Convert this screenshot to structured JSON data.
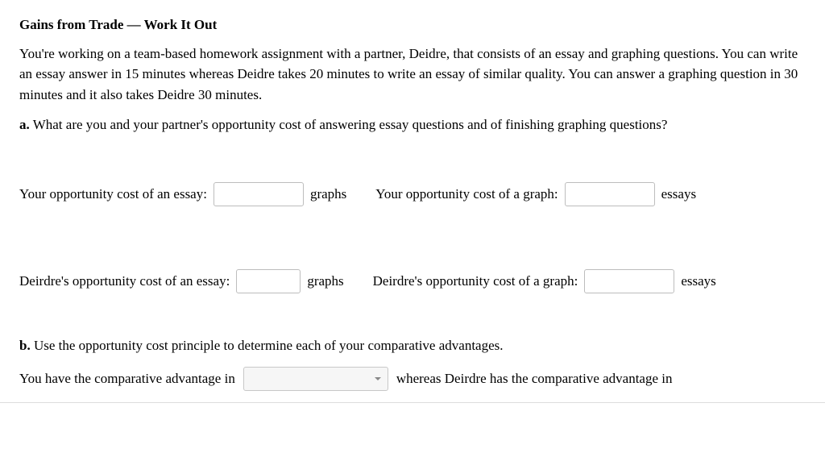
{
  "title": "Gains from Trade — Work It Out",
  "intro": "You're working on a team-based homework assignment with a partner, Deidre, that consists of an essay and graphing questions. You can write an essay answer in 15 minutes whereas Deidre takes 20 minutes to write an essay of similar quality. You can answer a graphing question in 30 minutes and it also takes Deidre 30 minutes.",
  "part_a": {
    "label": "a.",
    "text": "What are you and your partner's opportunity cost of answering essay questions and of finishing graphing questions?",
    "rows": [
      {
        "left_label": "Your opportunity cost of an essay:",
        "left_unit": "graphs",
        "right_label": "Your opportunity cost of a graph:",
        "right_unit": "essays"
      },
      {
        "left_label": "Deirdre's opportunity cost of an essay:",
        "left_unit": "graphs",
        "right_label": "Deirdre's opportunity cost of a graph:",
        "right_unit": "essays"
      }
    ]
  },
  "part_b": {
    "label": "b.",
    "text": "Use the opportunity cost principle to determine each of your comparative advantages.",
    "sentence_before": "You have the comparative advantage in",
    "sentence_after": "whereas Deirdre has the comparative advantage in"
  }
}
